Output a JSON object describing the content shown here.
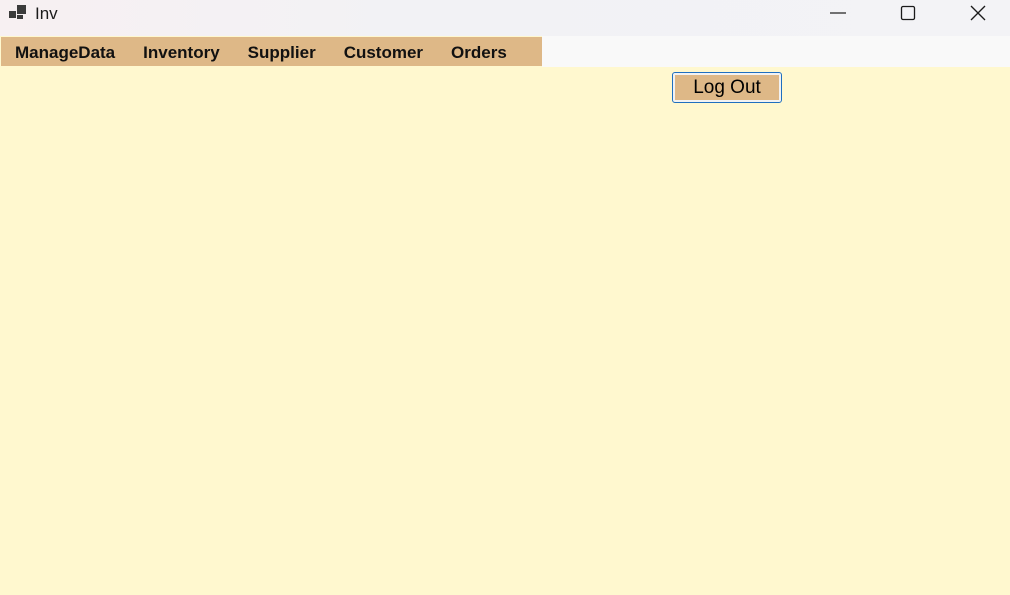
{
  "window": {
    "title": "Inv",
    "app_icon": "app-window-icon",
    "controls": {
      "minimize_icon": "minimize-icon",
      "maximize_icon": "maximize-icon",
      "close_icon": "close-icon"
    }
  },
  "menu": {
    "items": [
      {
        "label": "ManageData"
      },
      {
        "label": "Inventory"
      },
      {
        "label": "Supplier"
      },
      {
        "label": "Customer"
      },
      {
        "label": "Orders"
      }
    ]
  },
  "main": {
    "logout_label": "Log Out"
  },
  "colors": {
    "background": "#FFF8CF",
    "menu_background": "#DEB887",
    "button_background": "#DEB887",
    "button_border": "#1F6FBF"
  }
}
